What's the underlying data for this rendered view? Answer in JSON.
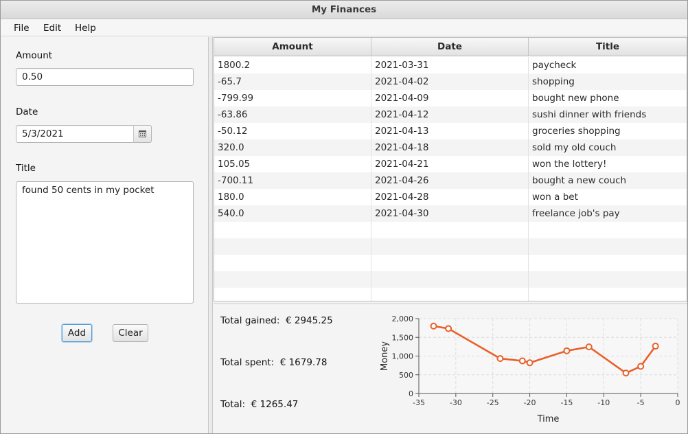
{
  "window": {
    "title": "My Finances"
  },
  "menu": {
    "file": "File",
    "edit": "Edit",
    "help": "Help"
  },
  "form": {
    "amount_label": "Amount",
    "amount_value": "0.50",
    "date_label": "Date",
    "date_value": "5/3/2021",
    "title_label": "Title",
    "title_value": "found 50 cents in my pocket",
    "add_label": "Add",
    "clear_label": "Clear"
  },
  "table": {
    "headers": [
      "Amount",
      "Date",
      "Title"
    ],
    "rows": [
      [
        "1800.2",
        "2021-03-31",
        "paycheck"
      ],
      [
        "-65.7",
        "2021-04-02",
        "shopping"
      ],
      [
        "-799.99",
        "2021-04-09",
        "bought new phone"
      ],
      [
        "-63.86",
        "2021-04-12",
        "sushi dinner with friends"
      ],
      [
        "-50.12",
        "2021-04-13",
        "groceries shopping"
      ],
      [
        "320.0",
        "2021-04-18",
        "sold my old couch"
      ],
      [
        "105.05",
        "2021-04-21",
        "won the lottery!"
      ],
      [
        "-700.11",
        "2021-04-26",
        "bought a new couch"
      ],
      [
        "180.0",
        "2021-04-28",
        "won a bet"
      ],
      [
        "540.0",
        "2021-04-30",
        "freelance job's pay"
      ]
    ]
  },
  "summary": {
    "gained": "Total gained:  € 2945.25",
    "spent": "Total spent:  € 1679.78",
    "total": "Total:  € 1265.47"
  },
  "colors": {
    "accent": "#e9602a",
    "focus": "#4f9ad6"
  },
  "chart_data": {
    "type": "line",
    "xlabel": "Time",
    "ylabel": "Money",
    "xlim": [
      -35,
      0
    ],
    "ylim": [
      0,
      2000
    ],
    "x_ticks": [
      "-35",
      "-30",
      "-25",
      "-20",
      "-15",
      "-10",
      "-5",
      "0"
    ],
    "y_ticks": [
      "0",
      "500",
      "1,000",
      "1,500",
      "2,000"
    ],
    "grid": true,
    "series": [
      {
        "x": [
          -33,
          -31,
          -24,
          -21,
          -20,
          -15,
          -12,
          -7,
          -5,
          -3
        ],
        "y": [
          1800.2,
          1734.5,
          934.51,
          870.65,
          820.53,
          1140.53,
          1245.58,
          545.47,
          725.47,
          1265.47
        ]
      }
    ]
  }
}
